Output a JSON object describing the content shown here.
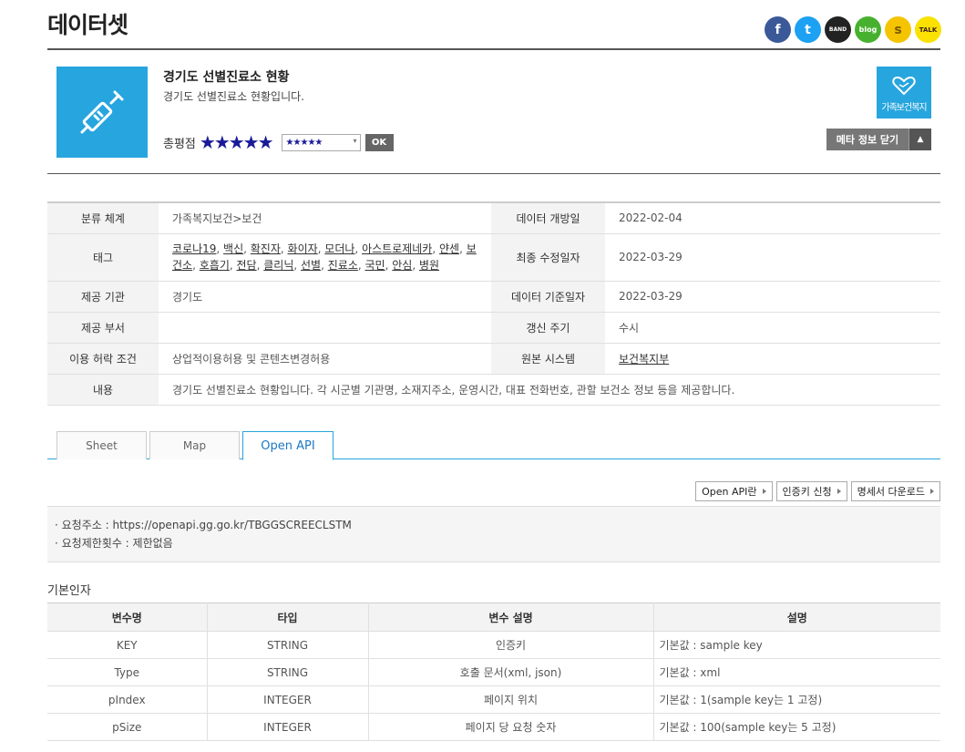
{
  "page": {
    "title": "데이터셋"
  },
  "share": [
    {
      "icon": "facebook-icon",
      "glyph": "f"
    },
    {
      "icon": "twitter-icon",
      "glyph": "t"
    },
    {
      "icon": "band-icon",
      "glyph": "BAND"
    },
    {
      "icon": "blog-icon",
      "glyph": "blog"
    },
    {
      "icon": "kakaostory-icon",
      "glyph": "s"
    },
    {
      "icon": "kakaotalk-icon",
      "glyph": "TALK"
    }
  ],
  "dataset": {
    "title": "경기도 선별진료소 현황",
    "description": "경기도 선별진료소 현황입니다.",
    "rating_label": "총평점",
    "rating_stars": "★★★★★",
    "rating_select": "★★★★★",
    "ok_label": "OK",
    "category_badge": "가족보건복지",
    "meta_toggle": "메타 정보 닫기",
    "thumb_icon": "syringe-icon"
  },
  "meta": {
    "classification_label": "분류 체계",
    "classification": "가족복지보건>보건",
    "open_date_label": "데이터 개방일",
    "open_date": "2022-02-04",
    "tags_label": "태그",
    "tags": [
      "코로나19",
      "백신",
      "확진자",
      "화이자",
      "모더나",
      "아스트로제네카",
      "얀센",
      "보건소",
      "호흡기",
      "전담",
      "클리닉",
      "선별",
      "진료소",
      "국민",
      "안심",
      "병원"
    ],
    "modified_label": "최종 수정일자",
    "modified": "2022-03-29",
    "provider_label": "제공 기관",
    "provider": "경기도",
    "base_date_label": "데이터 기준일자",
    "base_date": "2022-03-29",
    "dept_label": "제공 부서",
    "dept": "",
    "cycle_label": "갱신 주기",
    "cycle": "수시",
    "license_label": "이용 허락 조건",
    "license": "상업적이용허용 및 콘텐츠변경허용",
    "system_label": "원본 시스템",
    "system": "보건복지부",
    "content_label": "내용",
    "content": "경기도 선별진료소 현황입니다. 각 시군별 기관명, 소재지주소, 운영시간, 대표 전화번호, 관할 보건소 정보 등을 제공합니다."
  },
  "tabs": [
    "Sheet",
    "Map",
    "Open API"
  ],
  "api_links": [
    "Open API란",
    "인증키 신청",
    "명세서 다운로드"
  ],
  "request": {
    "url_line": "· 요청주소 : https://openapi.gg.go.kr/TBGGSCREECLSTM",
    "limit_line": "· 요청제한횟수 : 제한없음"
  },
  "params": {
    "section_title": "기본인자",
    "headers": [
      "변수명",
      "타입",
      "변수 설명",
      "설명"
    ],
    "rows": [
      [
        "KEY",
        "STRING",
        "인증키",
        "기본값 : sample key"
      ],
      [
        "Type",
        "STRING",
        "호출 문서(xml, json)",
        "기본값 : xml"
      ],
      [
        "pIndex",
        "INTEGER",
        "페이지 위치",
        "기본값 : 1(sample key는 1 고정)"
      ],
      [
        "pSize",
        "INTEGER",
        "페이지 당 요청 숫자",
        "기본값 : 100(sample key는 5 고정)"
      ]
    ]
  }
}
